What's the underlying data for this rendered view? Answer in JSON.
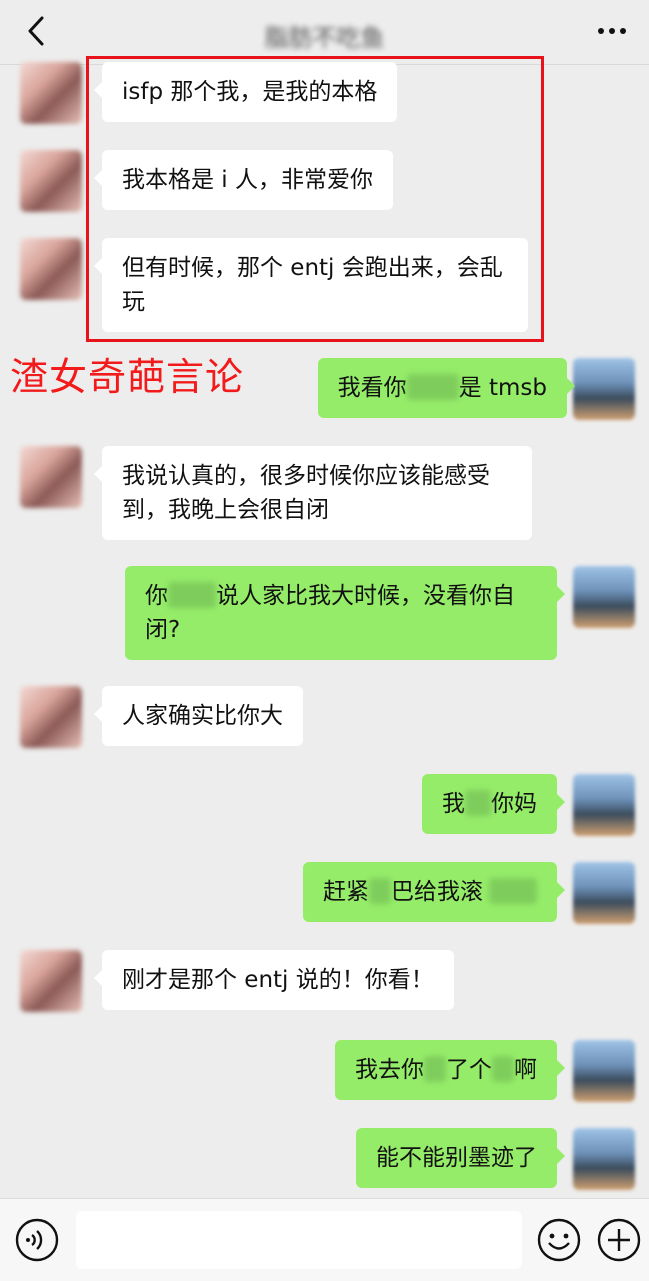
{
  "header": {
    "title": "脂肪不吃鱼",
    "back_icon": "chevron-left-icon",
    "more_icon": "more-dots-icon"
  },
  "annotation": "渣女奇葩言论",
  "messages": [
    {
      "side": "in",
      "text": "isfp 那个我，是我的本格"
    },
    {
      "side": "in",
      "text": "我本格是 i 人，非常爱你"
    },
    {
      "side": "in",
      "text": "但有时候，那个 entj 会跑出来，会乱玩"
    },
    {
      "side": "out",
      "pre": "我看你",
      "post": "是 tmsb"
    },
    {
      "side": "in",
      "text": "我说认真的，很多时候你应该能感受到，我晚上会很自闭"
    },
    {
      "side": "out",
      "pre": "你",
      "post": "说人家比我大时候，没看你自闭?"
    },
    {
      "side": "in",
      "text": "人家确实比你大"
    },
    {
      "side": "out",
      "pre": "我",
      "post": "你妈"
    },
    {
      "side": "out",
      "pre": "赶紧",
      "mid": "巴给我滚",
      "post": ""
    },
    {
      "side": "in",
      "text": "刚才是那个 entj 说的！你看！"
    },
    {
      "side": "out",
      "pre": "我去你",
      "mid": "了个",
      "post": "啊"
    },
    {
      "side": "out",
      "text": "能不能别墨迹了"
    }
  ],
  "inputbar": {
    "voice_icon": "voice-icon",
    "emoji_icon": "emoji-icon",
    "plus_icon": "plus-icon",
    "placeholder": ""
  },
  "colors": {
    "out_bubble": "#95ec69",
    "in_bubble": "#ffffff",
    "background": "#ededed",
    "annotation_red": "#f21a1a"
  }
}
